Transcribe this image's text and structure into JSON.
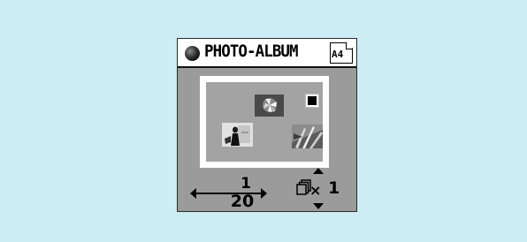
{
  "screen": {
    "title": "PHOTO-ALBUM",
    "paper_size": "A4",
    "page": {
      "current": "1",
      "total": "20"
    },
    "copies": {
      "symbol": "×",
      "count": "1"
    },
    "colors": {
      "background": "#cdecf3",
      "lcd_gray": "#9b9b9b",
      "sheet_white": "#ffffff",
      "ink": "#000000"
    },
    "icons": {
      "mode": "filled-circle-icon",
      "paper": "paper-size-icon",
      "page_prev": "left-arrow-icon",
      "page_next": "right-arrow-icon",
      "copies": "copies-icon",
      "copies_up": "up-arrow-icon",
      "copies_down": "down-arrow-icon",
      "selection": "selection-marker-icon"
    }
  }
}
